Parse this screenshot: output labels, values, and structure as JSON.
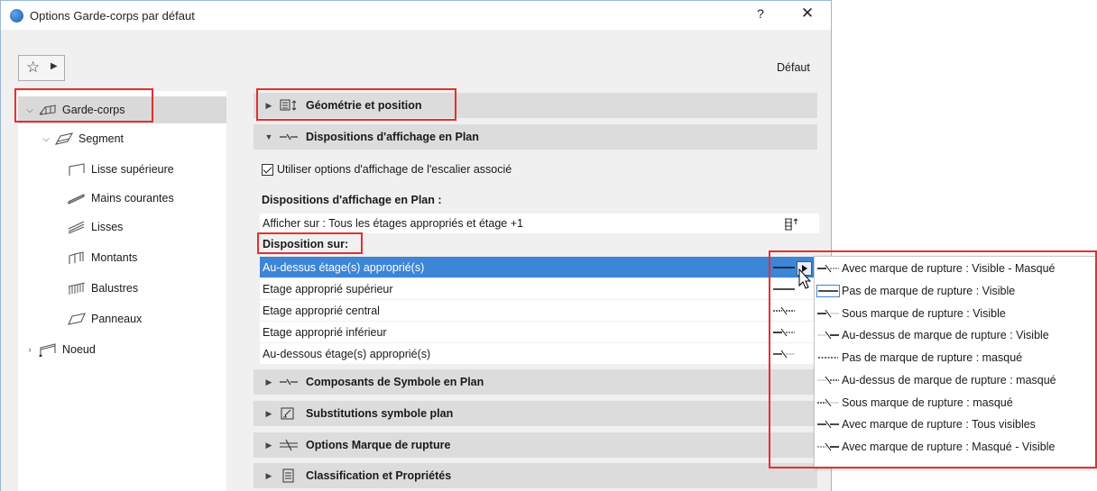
{
  "window": {
    "title": "Options Garde-corps par défaut",
    "help": "?",
    "close": "✕"
  },
  "toolbar": {
    "favorites_icon": "star-icon",
    "default_label": "Défaut"
  },
  "tree": {
    "items": [
      {
        "label": "Garde-corps",
        "icon": "railing-icon",
        "expanded": true
      },
      {
        "label": "Segment",
        "icon": "segment-icon",
        "expanded": true
      },
      {
        "label": "Lisse supérieure",
        "icon": "top-rail-icon"
      },
      {
        "label": "Mains courantes",
        "icon": "handrail-icon"
      },
      {
        "label": "Lisses",
        "icon": "rail-icon"
      },
      {
        "label": "Montants",
        "icon": "post-icon"
      },
      {
        "label": "Balustres",
        "icon": "baluster-icon"
      },
      {
        "label": "Panneaux",
        "icon": "panel-icon"
      },
      {
        "label": "Noeud",
        "icon": "node-icon",
        "expanded": false
      }
    ]
  },
  "sections": {
    "geometry": "Géométrie et position",
    "plan_display": "Dispositions d'affichage en Plan",
    "symbol_components": "Composants de Symbole en Plan",
    "symbol_overrides": "Substitutions symbole plan",
    "break_mark": "Options Marque de rupture",
    "classification": "Classification et Propriétés"
  },
  "plan_display": {
    "use_stair_checkbox": "Utiliser options d'affichage de l'escalier associé",
    "use_stair_checked": true,
    "heading": "Dispositions d'affichage en Plan :",
    "show_on": "Afficher sur : Tous les étages appropriés et étage +1",
    "disposition_heading": "Disposition sur:",
    "rows": [
      "Au-dessus étage(s) approprié(s)",
      "Etage approprié supérieur",
      "Etage approprié central",
      "Etage approprié inférieur",
      "Au-dessous étage(s) approprié(s)"
    ]
  },
  "popup": {
    "items": [
      "Avec marque de rupture : Visible - Masqué",
      "Pas de marque de rupture : Visible",
      "Sous marque de rupture : Visible",
      "Au-dessus de marque de rupture : Visible",
      "Pas de marque de rupture : masqué",
      "Au-dessus de marque de rupture : masqué",
      "Sous marque de rupture : masqué",
      "Avec marque de rupture : Tous visibles",
      "Avec marque de rupture : Masqué - Visible"
    ]
  },
  "colors": {
    "selection": "#3d85d6",
    "highlight_box": "#e53030",
    "section_bg": "#dcdcdc"
  }
}
